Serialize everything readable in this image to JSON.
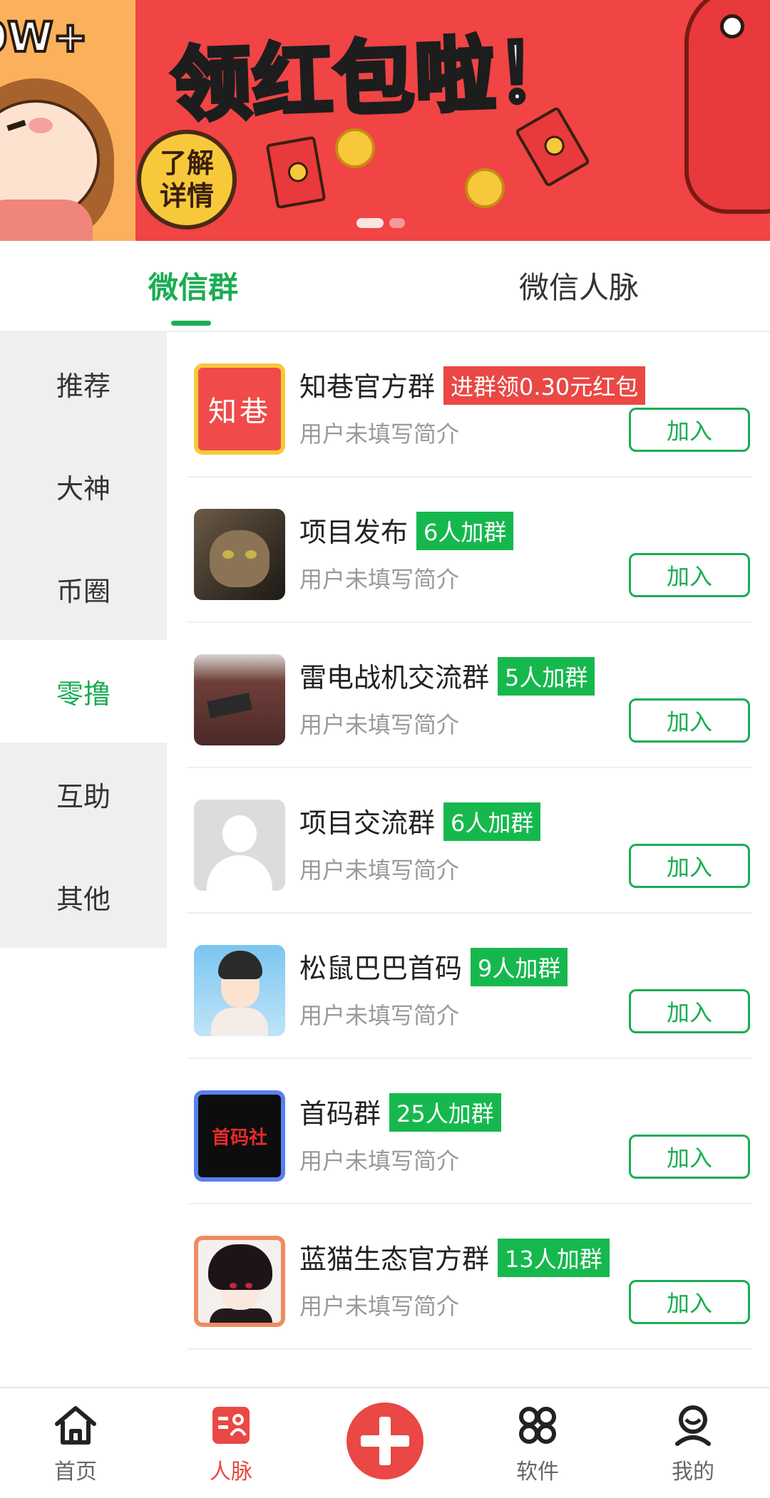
{
  "banner": {
    "left_text": "0W+",
    "title": "领红包啦！",
    "learn_more": [
      "了解",
      "详情"
    ]
  },
  "tabs": [
    {
      "label": "微信群",
      "active": true
    },
    {
      "label": "微信人脉",
      "active": false
    }
  ],
  "sidebar": {
    "items": [
      {
        "label": "推荐",
        "active": false
      },
      {
        "label": "大神",
        "active": false
      },
      {
        "label": "币圈",
        "active": false
      },
      {
        "label": "零撸",
        "active": true
      },
      {
        "label": "互助",
        "active": false
      },
      {
        "label": "其他",
        "active": false
      }
    ]
  },
  "groups": [
    {
      "name": "知巷官方群",
      "badge": "进群领0.30元红包",
      "badge_color": "#e94844",
      "desc": "用户未填写简介",
      "join": "加入",
      "avatar_text": "知巷",
      "avatar": "zhixiang-logo"
    },
    {
      "name": "项目发布",
      "badge": "6人加群",
      "badge_color": "#16b84e",
      "desc": "用户未填写简介",
      "join": "加入",
      "avatar": "cat-photo"
    },
    {
      "name": "雷电战机交流群",
      "badge": "5人加群",
      "badge_color": "#16b84e",
      "desc": "用户未填写简介",
      "join": "加入",
      "avatar": "robe-photo"
    },
    {
      "name": "项目交流群",
      "badge": "6人加群",
      "badge_color": "#16b84e",
      "desc": "用户未填写简介",
      "join": "加入",
      "avatar": "default-avatar"
    },
    {
      "name": "松鼠巴巴首码",
      "badge": "9人加群",
      "badge_color": "#16b84e",
      "desc": "用户未填写简介",
      "join": "加入",
      "avatar": "cartoon-boy"
    },
    {
      "name": "首码群",
      "badge": "25人加群",
      "badge_color": "#16b84e",
      "desc": "用户未填写简介",
      "join": "加入",
      "avatar_text": "首码社",
      "avatar": "shouma-logo"
    },
    {
      "name": "蓝猫生态官方群",
      "badge": "13人加群",
      "badge_color": "#16b84e",
      "desc": "用户未填写简介",
      "join": "加入",
      "avatar": "anime-character"
    }
  ],
  "bottom_nav": {
    "items": [
      {
        "label": "首页",
        "icon": "home-icon",
        "active": false
      },
      {
        "label": "人脉",
        "icon": "contacts-icon",
        "active": true
      },
      {
        "label": "",
        "icon": "plus-icon",
        "active": false
      },
      {
        "label": "软件",
        "icon": "apps-icon",
        "active": false
      },
      {
        "label": "我的",
        "icon": "profile-icon",
        "active": false
      }
    ]
  },
  "colors": {
    "accent_green": "#1aad53",
    "accent_red": "#e94844",
    "sidebar_bg": "#efefef",
    "muted_text": "#9a9a9a"
  }
}
